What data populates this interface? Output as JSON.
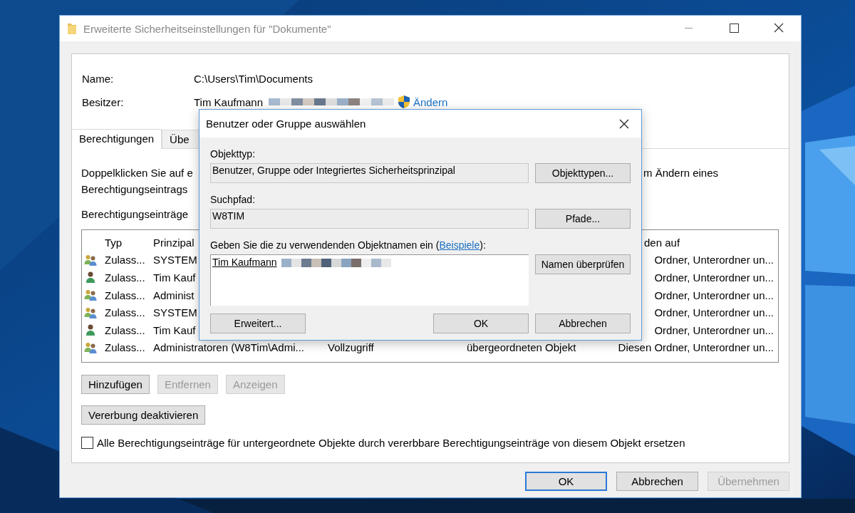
{
  "window": {
    "title": "Erweiterte Sicherheitseinstellungen für \"Dokumente\""
  },
  "name": {
    "label": "Name:",
    "value": "C:\\Users\\Tim\\Documents"
  },
  "owner": {
    "label": "Besitzer:",
    "value": "Tim Kaufmann",
    "change_link": "Ändern"
  },
  "tabs": [
    {
      "label": "Berechtigungen",
      "selected": true
    },
    {
      "label": "Übe",
      "selected": false
    }
  ],
  "description": {
    "left": "Doppelklicken Sie auf e",
    "right": "m Ändern eines",
    "line_2": "Berechtigungseintrags"
  },
  "entries_label": "Berechtigungseinträge",
  "table": {
    "header": {
      "type": "Typ",
      "principal": "Prinzipal",
      "applies_to": "den auf"
    },
    "rows": [
      {
        "kind": "group",
        "type": "Zulass...",
        "principal": "SYSTEM",
        "applies_to": "Ordner, Unterordner un..."
      },
      {
        "kind": "user",
        "type": "Zulass...",
        "principal": "Tim Kauf",
        "applies_to": "Ordner, Unterordner un..."
      },
      {
        "kind": "group",
        "type": "Zulass...",
        "principal": "Administ",
        "applies_to": "Ordner, Unterordner un..."
      },
      {
        "kind": "group",
        "type": "Zulass...",
        "principal": "SYSTEM",
        "applies_to": "Ordner, Unterordner un..."
      },
      {
        "kind": "user",
        "type": "Zulass...",
        "principal": "Tim Kauf",
        "applies_to": "Ordner, Unterordner un..."
      },
      {
        "kind": "group",
        "type": "Zulass...",
        "principal": "Administratoren (W8Tim\\Admi...",
        "access": "Vollzugriff",
        "inherited_from": "übergeordneten Objekt",
        "applies_to": "Diesen Ordner, Unterordner un..."
      }
    ]
  },
  "entry_buttons": [
    {
      "label": "Hinzufügen",
      "disabled": false
    },
    {
      "label": "Entfernen",
      "disabled": true
    },
    {
      "label": "Anzeigen",
      "disabled": true
    }
  ],
  "inheritance_button": "Vererbung deaktivieren",
  "replace_checkbox": {
    "label": "Alle Berechtigungseinträge für untergeordnete Objekte durch vererbbare Berechtigungseinträge von diesem Objekt ersetzen",
    "checked": false
  },
  "footer_buttons": [
    {
      "label": "OK",
      "default": true,
      "disabled": false
    },
    {
      "label": "Abbrechen",
      "default": false,
      "disabled": false
    },
    {
      "label": "Übernehmen",
      "default": false,
      "disabled": true
    }
  ],
  "dialog": {
    "title": "Benutzer oder Gruppe auswählen",
    "object_type": {
      "label": "Objekttyp:",
      "value": "Benutzer, Gruppe oder Integriertes Sicherheitsprinzipal",
      "button": "Objekttypen..."
    },
    "search_path": {
      "label": "Suchpfad:",
      "value": "W8TIM",
      "button": "Pfade..."
    },
    "names": {
      "label": "Geben Sie die zu verwendenden Objektnamen ein (",
      "link": "Beispiele",
      "label_end": "):",
      "value": "Tim Kaufmann",
      "button": "Namen überprüfen"
    },
    "advanced_button": "Erweitert...",
    "ok_button": "OK",
    "cancel_button": "Abbrechen"
  }
}
